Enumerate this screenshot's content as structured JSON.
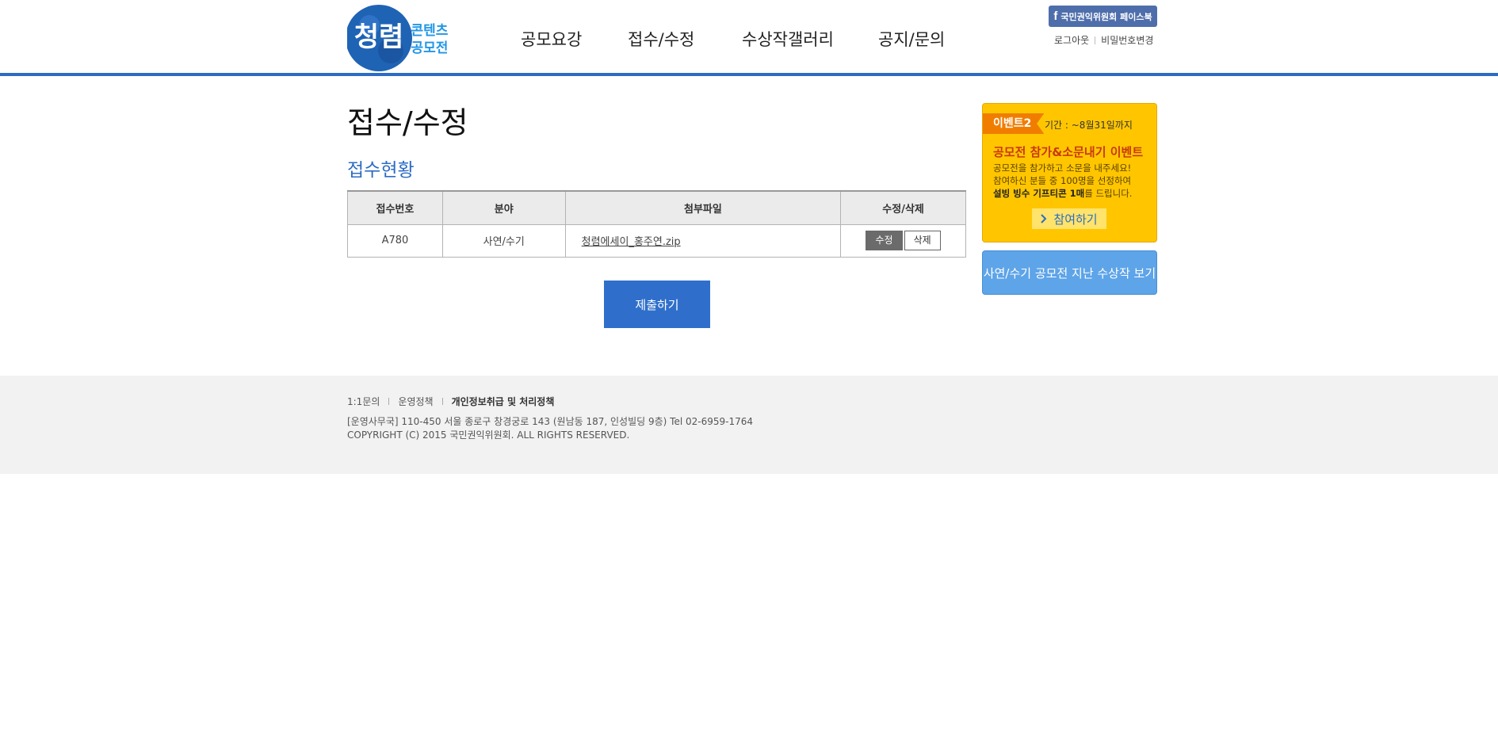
{
  "header": {
    "logo": {
      "main_text": "청렴",
      "sub_text_1": "콘텐츠",
      "sub_text_2": "공모전"
    },
    "nav": [
      {
        "label": "공모요강"
      },
      {
        "label": "접수/수정"
      },
      {
        "label": "수상작갤러리"
      },
      {
        "label": "공지/문의"
      }
    ],
    "facebook_label": "국민권익위원회 페이스북",
    "util_links": [
      {
        "label": "로그아웃"
      },
      {
        "label": "비밀번호변경"
      }
    ]
  },
  "main": {
    "page_title": "접수/수정",
    "section_title": "접수현황",
    "table": {
      "headers": [
        "접수번호",
        "분야",
        "첨부파일",
        "수정/삭제"
      ],
      "rows": [
        {
          "number": "A780",
          "category": "사연/수기",
          "file": "청렴에세이_홍주연.zip",
          "edit_label": "수정",
          "delete_label": "삭제"
        }
      ]
    },
    "submit_label": "제출하기"
  },
  "sidebar": {
    "event": {
      "tag": "이벤트2",
      "period": "기간 : ~8월31일까지",
      "title": "공모전 참가&소문내기 이벤트",
      "desc_line1": "공모전을 참가하고 소문을 내주세요!",
      "desc_line2": "참여하신 분들 중 100명을 선정하여",
      "desc_line3_bold": "설빙 빙수 기프티콘 1매",
      "desc_line3_rest": "를 드립니다.",
      "cta": "참여하기"
    },
    "past_winners_label": "사연/수기 공모전 지난 수상작 보기"
  },
  "footer": {
    "links": [
      {
        "label": "1:1문의"
      },
      {
        "label": "운영정책"
      },
      {
        "label": "개인정보취급 및 처리정책"
      }
    ],
    "address": "[운영사무국] 110-450 서울 종로구 창경궁로 143 (원남동 187, 인성빌딩 9층) Tel 02-6959-1764",
    "copyright": "COPYRIGHT (C) 2015 국민권익위원회. ALL RIGHTS RESERVED."
  },
  "colors": {
    "accent_blue": "#2d6cc4",
    "event_yellow": "#ffc600",
    "event_orange": "#f07d00",
    "past_blue": "#5ea4e8",
    "footer_bg": "#f2f2f2"
  }
}
